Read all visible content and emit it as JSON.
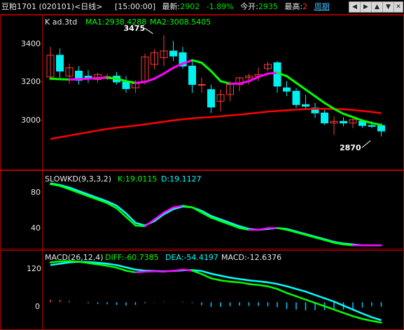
{
  "titlebar": {
    "symbol": "豆粕1701 (020101)<日线>",
    "time": "[15:00:00]",
    "last_label": "最新:",
    "last_value": "2902",
    "change": "-1.89%",
    "open_label": "今开:",
    "open_value": "2935",
    "high_label": "最高:",
    "high_value": "2",
    "period": "周期",
    "icons": [
      "left-arrow-icon",
      "right-arrow-icon",
      "up-arrow-icon",
      "down-arrow-icon",
      "close-icon"
    ]
  },
  "colors": {
    "background": "#000000",
    "frame": "#b40000",
    "up_candle": "#ff3a3a",
    "down_candle": "#00f0f0",
    "ma1": "#ff00ff",
    "ma1_alt": "#00ff00",
    "ma2": "#ff0000",
    "k_line": "#ff00ff",
    "d_line": "#00ffff",
    "diff_line": "#00ff00",
    "dea_line": "#00ffff",
    "macd_pos": "#ff3a3a",
    "macd_neg": "#00c8ff"
  },
  "chart_data": [
    {
      "type": "candlestick",
      "title": "K  ad.3td",
      "legend": [
        {
          "name": "MA1",
          "text": "MA1:2938.4288"
        },
        {
          "name": "MA2",
          "text": "MA2:3008.5405"
        }
      ],
      "y_ticks": [
        3000,
        3200,
        3400
      ],
      "ylim": [
        2760,
        3580
      ],
      "annotations": [
        {
          "text": "3475",
          "x_index": 11,
          "y": 3475
        },
        {
          "text": "2870",
          "x_index": 34,
          "y": 2870
        }
      ],
      "candles": [
        {
          "o": 3225,
          "h": 3405,
          "l": 3205,
          "c": 3355
        },
        {
          "o": 3355,
          "h": 3395,
          "l": 3220,
          "c": 3260
        },
        {
          "o": 3230,
          "h": 3305,
          "l": 3185,
          "c": 3280
        },
        {
          "o": 3260,
          "h": 3290,
          "l": 3180,
          "c": 3205
        },
        {
          "o": 3230,
          "h": 3265,
          "l": 3190,
          "c": 3215
        },
        {
          "o": 3210,
          "h": 3250,
          "l": 3190,
          "c": 3240
        },
        {
          "o": 3225,
          "h": 3245,
          "l": 3205,
          "c": 3228
        },
        {
          "o": 3230,
          "h": 3255,
          "l": 3180,
          "c": 3195
        },
        {
          "o": 3195,
          "h": 3230,
          "l": 3130,
          "c": 3155
        },
        {
          "o": 3160,
          "h": 3205,
          "l": 3130,
          "c": 3185
        },
        {
          "o": 3200,
          "h": 3365,
          "l": 3180,
          "c": 3345
        },
        {
          "o": 3300,
          "h": 3390,
          "l": 3270,
          "c": 3370
        },
        {
          "o": 3340,
          "h": 3475,
          "l": 3290,
          "c": 3380
        },
        {
          "o": 3380,
          "h": 3440,
          "l": 3320,
          "c": 3350
        },
        {
          "o": 3370,
          "h": 3405,
          "l": 3275,
          "c": 3290
        },
        {
          "o": 3290,
          "h": 3320,
          "l": 3130,
          "c": 3180
        },
        {
          "o": 3180,
          "h": 3220,
          "l": 3130,
          "c": 3180
        },
        {
          "o": 3150,
          "h": 3180,
          "l": 3010,
          "c": 3045
        },
        {
          "o": 3080,
          "h": 3150,
          "l": 3020,
          "c": 3120
        },
        {
          "o": 3120,
          "h": 3200,
          "l": 3080,
          "c": 3180
        },
        {
          "o": 3180,
          "h": 3225,
          "l": 3140,
          "c": 3220
        },
        {
          "o": 3220,
          "h": 3245,
          "l": 3180,
          "c": 3230
        },
        {
          "o": 3230,
          "h": 3280,
          "l": 3200,
          "c": 3240
        },
        {
          "o": 3275,
          "h": 3315,
          "l": 3260,
          "c": 3300
        },
        {
          "o": 3310,
          "h": 3320,
          "l": 3130,
          "c": 3170
        },
        {
          "o": 3160,
          "h": 3200,
          "l": 3110,
          "c": 3140
        },
        {
          "o": 3140,
          "h": 3160,
          "l": 3040,
          "c": 3060
        },
        {
          "o": 3060,
          "h": 3120,
          "l": 3030,
          "c": 3050
        },
        {
          "o": 3040,
          "h": 3070,
          "l": 2980,
          "c": 3010
        },
        {
          "o": 3010,
          "h": 3030,
          "l": 2940,
          "c": 2950
        },
        {
          "o": 2950,
          "h": 2990,
          "l": 2880,
          "c": 2960
        },
        {
          "o": 2960,
          "h": 2985,
          "l": 2930,
          "c": 2950
        },
        {
          "o": 2950,
          "h": 2990,
          "l": 2920,
          "c": 2970
        },
        {
          "o": 2960,
          "h": 2970,
          "l": 2920,
          "c": 2935
        },
        {
          "o": 2935,
          "h": 2960,
          "l": 2920,
          "c": 2930
        },
        {
          "o": 2935,
          "h": 2950,
          "l": 2870,
          "c": 2902
        }
      ],
      "ma1": [
        3215,
        3212,
        3210,
        3212,
        3215,
        3218,
        3220,
        3215,
        3200,
        3190,
        3195,
        3215,
        3245,
        3280,
        3305,
        3325,
        3310,
        3260,
        3200,
        3185,
        3185,
        3200,
        3225,
        3245,
        3250,
        3230,
        3190,
        3150,
        3110,
        3070,
        3035,
        3005,
        2985,
        2965,
        2950,
        2938
      ],
      "ma2": [
        2855,
        2865,
        2875,
        2885,
        2895,
        2905,
        2915,
        2922,
        2928,
        2935,
        2942,
        2950,
        2958,
        2966,
        2972,
        2978,
        2982,
        2986,
        2990,
        2995,
        3000,
        3006,
        3012,
        3018,
        3022,
        3026,
        3030,
        3033,
        3035,
        3035,
        3034,
        3032,
        3028,
        3022,
        3016,
        3009
      ]
    },
    {
      "type": "line",
      "title": "SLOWKD(9,3,3,2)",
      "legend": [
        {
          "name": "K",
          "text": "K:19.0115"
        },
        {
          "name": "D",
          "text": "D:19.1127"
        }
      ],
      "y_ticks": [
        40,
        80
      ],
      "ylim": [
        15,
        98
      ],
      "series": [
        {
          "name": "K",
          "values": [
            90,
            88,
            84,
            80,
            76,
            72,
            68,
            62,
            52,
            42,
            41,
            49,
            57,
            63,
            65,
            63,
            57,
            51,
            47,
            43,
            39,
            37,
            37,
            39,
            39,
            37,
            34,
            31,
            28,
            25,
            22,
            20,
            19,
            19,
            19,
            19
          ]
        },
        {
          "name": "D",
          "values": [
            91,
            89,
            86,
            82,
            78,
            74,
            70,
            65,
            56,
            45,
            42,
            47,
            55,
            61,
            64,
            63,
            59,
            53,
            49,
            45,
            41,
            38,
            37,
            38,
            39,
            38,
            35,
            32,
            29,
            26,
            23,
            21,
            20,
            19,
            19,
            19
          ]
        }
      ]
    },
    {
      "type": "line",
      "title": "MACD(26,12,4)",
      "legend": [
        {
          "name": "DIFF",
          "text": "DIFF:-60.7385"
        },
        {
          "name": "DEA",
          "text": "DEA:-54.4197"
        },
        {
          "name": "MACD",
          "text": "MACD:-12.6376"
        }
      ],
      "y_ticks": [
        0,
        120
      ],
      "ylim": [
        -75,
        140
      ],
      "series": [
        {
          "name": "DIFF",
          "values": [
            120,
            123,
            124,
            122,
            118,
            114,
            110,
            104,
            95,
            90,
            92,
            93,
            92,
            95,
            98,
            95,
            85,
            72,
            66,
            62,
            60,
            55,
            52,
            48,
            40,
            28,
            18,
            8,
            -2,
            -12,
            -22,
            -32,
            -42,
            -50,
            -56,
            -61
          ]
        },
        {
          "name": "DEA",
          "values": [
            112,
            116,
            120,
            122,
            121,
            119,
            116,
            112,
            105,
            98,
            95,
            94,
            93,
            94,
            96,
            97,
            94,
            86,
            80,
            74,
            70,
            66,
            63,
            60,
            55,
            48,
            40,
            32,
            22,
            12,
            2,
            -10,
            -22,
            -34,
            -45,
            -54
          ]
        },
        {
          "name": "MACD",
          "values": [
            8,
            7,
            4,
            0,
            -3,
            -5,
            -6,
            -8,
            -10,
            -8,
            -3,
            -1,
            -1,
            1,
            2,
            -2,
            -9,
            -14,
            -14,
            -12,
            -10,
            -11,
            -11,
            -12,
            -15,
            -20,
            -22,
            -24,
            -24,
            -24,
            -24,
            -22,
            -20,
            -16,
            -11,
            -13
          ]
        }
      ]
    }
  ]
}
